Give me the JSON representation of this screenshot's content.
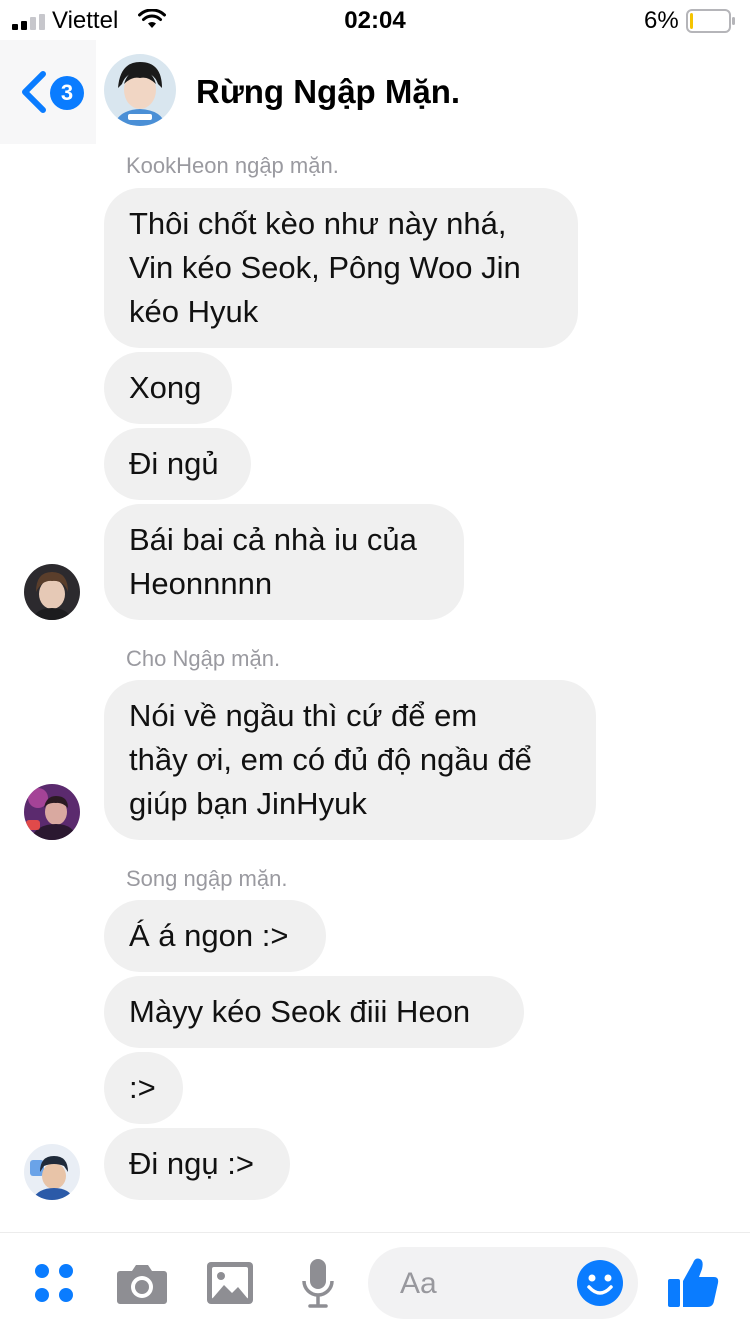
{
  "status_bar": {
    "carrier": "Viettel",
    "time": "02:04",
    "battery_percent": "6%",
    "battery_level": 0.06
  },
  "header": {
    "back_badge": "3",
    "title": "Rừng Ngập Mặn."
  },
  "conversation": [
    {
      "sender": "KookHeon ngập mặn.",
      "messages": [
        "Thôi chốt kèo như này nhá,\nVin kéo Seok, Pông Woo Jin\nkéo Hyuk",
        "Xong",
        "Đi ngủ",
        "Bái bai cả nhà iu của\nHeonnnnn"
      ]
    },
    {
      "sender": "Cho Ngập mặn.",
      "messages": [
        "Nói về ngầu thì cứ để em\nthầy ơi, em có đủ độ ngầu để\ngiúp bạn JinHyuk"
      ]
    },
    {
      "sender": "Song ngập mặn.",
      "messages": [
        "Á á ngon :>",
        "Màyy kéo Seok điii Heon",
        ":>",
        "Đi ngụ :>"
      ]
    }
  ],
  "composer": {
    "placeholder": "Aa"
  },
  "colors": {
    "accent": "#0a7cff",
    "bubble": "#f0f0f0",
    "sender_label": "#9a9aa0",
    "icon_gray": "#8e8e93"
  },
  "icons": [
    "back-chevron-icon",
    "more-apps-icon",
    "camera-icon",
    "image-icon",
    "microphone-icon",
    "emoji-icon",
    "thumbs-up-icon",
    "wifi-icon",
    "signal-icon",
    "battery-icon"
  ]
}
